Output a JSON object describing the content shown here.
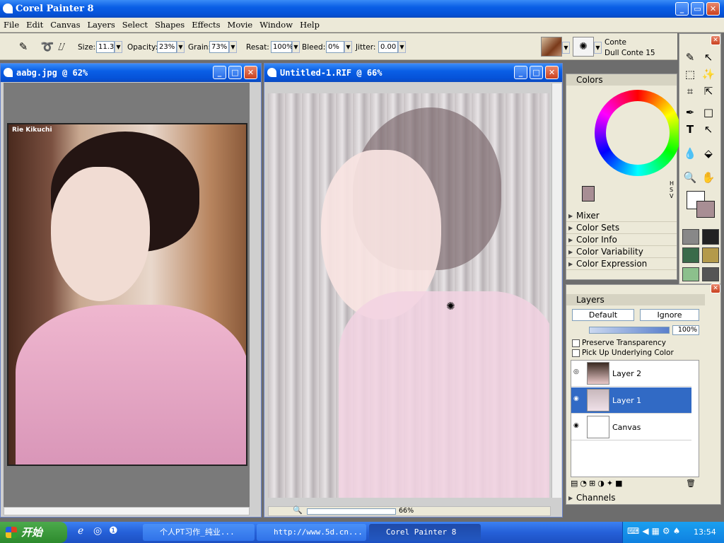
{
  "app": {
    "title": "Corel Painter 8"
  },
  "menu": [
    "File",
    "Edit",
    "Canvas",
    "Layers",
    "Select",
    "Shapes",
    "Effects",
    "Movie",
    "Window",
    "Help"
  ],
  "props": {
    "size_label": "Size:",
    "size": "11.3",
    "opacity_label": "Opacity:",
    "opacity": "23%",
    "grain_label": "Grain:",
    "grain": "73%",
    "resat_label": "Resat:",
    "resat": "100%",
    "bleed_label": "Bleed:",
    "bleed": "0%",
    "jitter_label": "Jitter:",
    "jitter": "0.00",
    "brush_category": "Conte",
    "brush_variant": "Dull Conte 15"
  },
  "doc1": {
    "title": "aabg.jpg @ 62%",
    "photo_caption": "Rie Kikuchi"
  },
  "doc2": {
    "title": "Untitled-1.RIF @ 66%",
    "zoom": "66%"
  },
  "colors": {
    "title": "Colors",
    "sections": [
      "Mixer",
      "Color Sets",
      "Color Info",
      "Color Variability",
      "Color Expression"
    ],
    "hsv": "HSV",
    "main_color": "#a88e94"
  },
  "layers": {
    "title": "Layers",
    "composite_method": "Default",
    "composite_depth": "Ignore",
    "opacity": "100%",
    "preserve_transparency": "Preserve Transparency",
    "pick_up_underlying": "Pick Up Underlying Color",
    "items": [
      {
        "name": "Layer 2"
      },
      {
        "name": "Layer 1"
      },
      {
        "name": "Canvas"
      }
    ],
    "channels": "Channels"
  },
  "taskbar": {
    "start": "开始",
    "tasks": [
      "个人PT习作_纯业...",
      "http://www.5d.cn...",
      "Corel Painter 8"
    ],
    "clock": "13:54"
  }
}
